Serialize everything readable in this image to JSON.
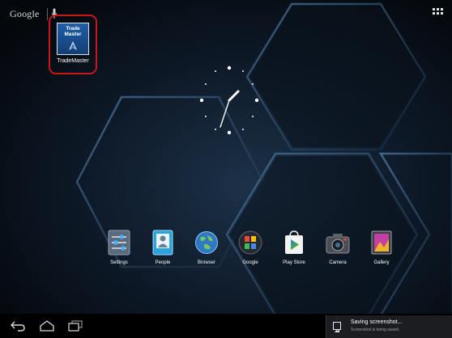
{
  "search": {
    "label": "Google"
  },
  "shortcut": {
    "icon_text": "Trade Master",
    "label": "TradeMaster"
  },
  "dock": [
    {
      "label": "Settings",
      "icon": "settings-icon"
    },
    {
      "label": "People",
      "icon": "people-icon"
    },
    {
      "label": "Browser",
      "icon": "browser-globe-icon"
    },
    {
      "label": "Google",
      "icon": "google-folder-icon"
    },
    {
      "label": "Play Store",
      "icon": "play-store-icon"
    },
    {
      "label": "Camera",
      "icon": "camera-icon"
    },
    {
      "label": "Gallery",
      "icon": "gallery-icon"
    }
  ],
  "notification": {
    "title": "Saving screenshot...",
    "text": "Screenshot is being saved."
  },
  "colors": {
    "highlight_border": "#d0141c",
    "accent": "#2b8fd0",
    "navbar": "#000000"
  }
}
